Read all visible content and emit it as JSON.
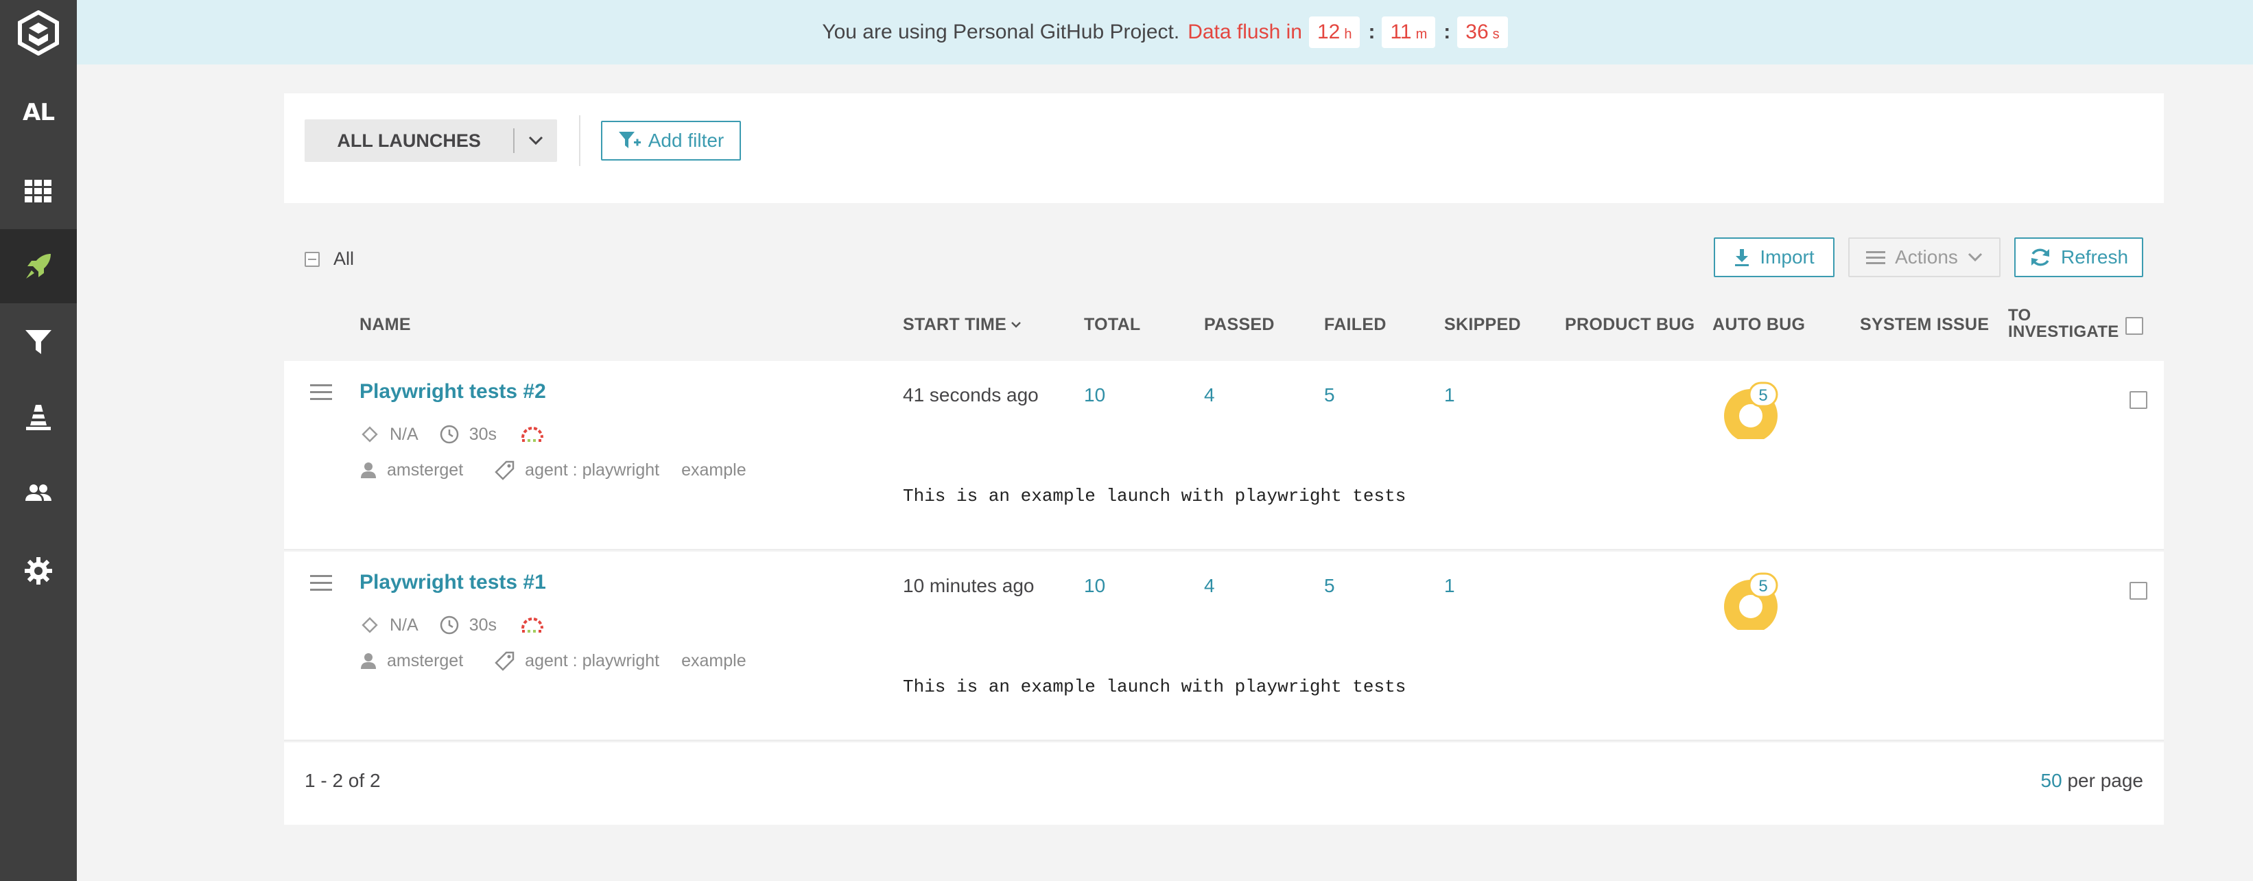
{
  "sidebar": {
    "project_abbr": "AL",
    "items": [
      {
        "icon": "dashboard-grid-icon",
        "active": false
      },
      {
        "icon": "launches-rocket-icon",
        "active": true
      },
      {
        "icon": "filters-funnel-icon",
        "active": false
      },
      {
        "icon": "debug-cone-icon",
        "active": false
      },
      {
        "icon": "members-icon",
        "active": false
      },
      {
        "icon": "settings-gear-icon",
        "active": false
      }
    ]
  },
  "banner": {
    "text": "You are using Personal GitHub Project.",
    "flush_label": "Data flush in",
    "hours": "12",
    "hours_unit": "h",
    "minutes": "11",
    "minutes_unit": "m",
    "seconds": "36",
    "seconds_unit": "s",
    "separator": ":"
  },
  "filters": {
    "launch_select": "ALL LAUNCHES",
    "add_filter": "Add filter"
  },
  "toolbar": {
    "select_all_label": "All",
    "import": "Import",
    "actions": "Actions",
    "refresh": "Refresh"
  },
  "table": {
    "headers": {
      "name": "NAME",
      "start_time": "START TIME",
      "total": "TOTAL",
      "passed": "PASSED",
      "failed": "FAILED",
      "skipped": "SKIPPED",
      "product_bug": "PRODUCT BUG",
      "auto_bug": "AUTO BUG",
      "system_issue": "SYSTEM ISSUE",
      "to_investigate_1": "TO",
      "to_investigate_2": "INVESTIGATE"
    },
    "rows": [
      {
        "name": "Playwright tests #2",
        "attribute_na": "N/A",
        "duration": "30s",
        "owner": "amsterget",
        "tag_attr": "agent : playwright",
        "tag_example": "example",
        "start_time": "41 seconds ago",
        "total": "10",
        "passed": "4",
        "failed": "5",
        "skipped": "1",
        "auto_bug": "5",
        "description": "This is an example launch with playwright tests"
      },
      {
        "name": "Playwright tests #1",
        "attribute_na": "N/A",
        "duration": "30s",
        "owner": "amsterget",
        "tag_attr": "agent : playwright",
        "tag_example": "example",
        "start_time": "10 minutes ago",
        "total": "10",
        "passed": "4",
        "failed": "5",
        "skipped": "1",
        "auto_bug": "5",
        "description": "This is an example launch with playwright tests"
      }
    ]
  },
  "footer": {
    "range": "1 - 2 of 2",
    "per_page_count": "50",
    "per_page_label": "per page"
  },
  "colors": {
    "accent": "#3b9bb0",
    "link": "#2f8fa6",
    "banner_bg": "#dcf0f5",
    "flush_red": "#e4463f",
    "auto_bug_yellow": "#f7c745",
    "sidebar_bg": "#3f3f3f",
    "rocket_green": "#a2cd5f"
  }
}
